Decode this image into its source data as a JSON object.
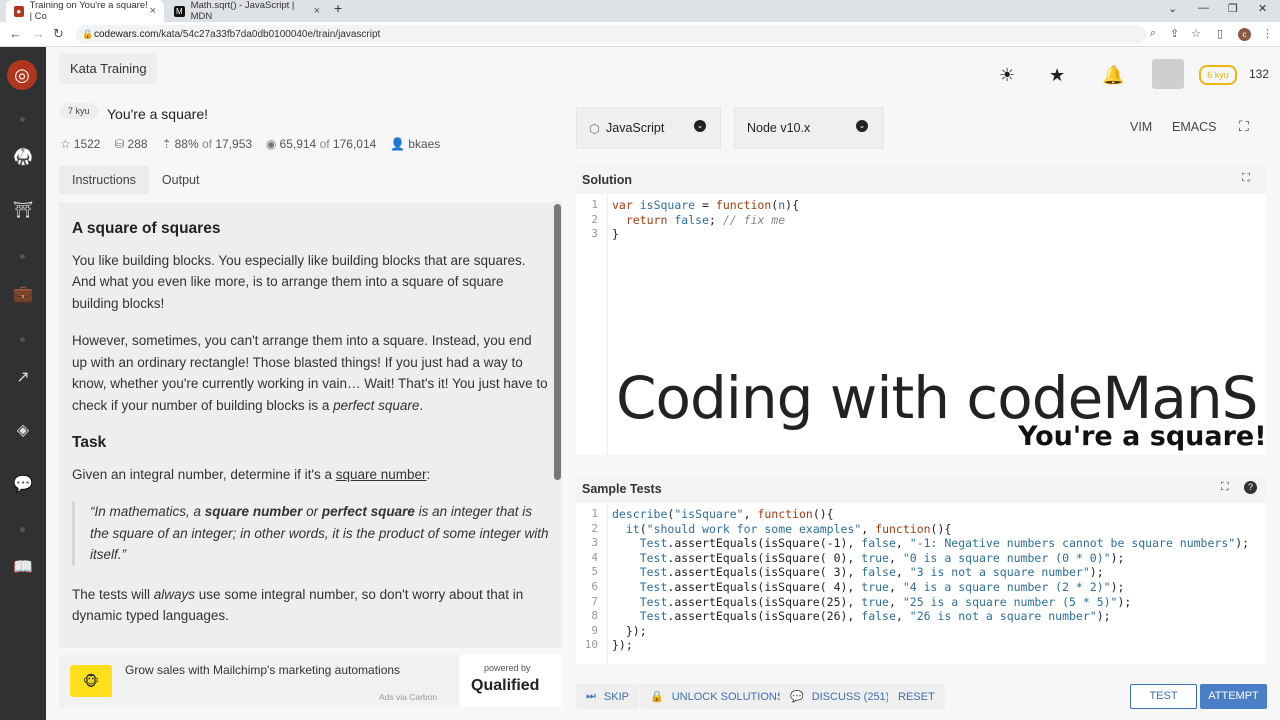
{
  "browser": {
    "tabs": [
      {
        "title": "Training on You're a square! | Co",
        "active": true
      },
      {
        "title": "Math.sqrt() - JavaScript | MDN",
        "active": false
      }
    ],
    "url_host": "codewars.com",
    "url_path": "/kata/54c27a33fb7da0db0100040e/train/javascript",
    "profile_initial": "c"
  },
  "header": {
    "section_label": "Kata Training",
    "rank_badge": "6 kyu",
    "honor": "132"
  },
  "kata": {
    "kyu": "7 kyu",
    "title": "You're a square!",
    "stars": "1522",
    "collections": "288",
    "satisfaction": "88%",
    "votes": "17,953",
    "completed": "65,914",
    "attempted": "176,014",
    "author": "bkaes"
  },
  "left_tabs": [
    "Instructions",
    "Output"
  ],
  "description": {
    "heading1": "A square of squares",
    "p1": "You like building blocks. You especially like building blocks that are squares. And what you even like more, is to arrange them into a square of square building blocks!",
    "p2a": "However, sometimes, you can't arrange them into a square. Instead, you end up with an ordinary rectangle! Those blasted things! If you just had a way to know, whether you're currently working in vain… Wait! That's it! You just have to check if your number of building blocks is a ",
    "p2em": "perfect square",
    "p2b": ".",
    "heading2": "Task",
    "p3a": "Given an integral number, determine if it's a ",
    "p3link": "square number",
    "p3b": ":",
    "q1": "“In mathematics, a ",
    "q2": "square number",
    "q3": " or ",
    "q4": "perfect square",
    "q5": " is an integer that is the square of an integer; in other words, it is the product of some integer with itself.”",
    "p4a": "The tests will ",
    "p4em": "always",
    "p4b": " use some integral number, so don't worry about that in dynamic typed languages."
  },
  "ad": {
    "text": "Grow sales with Mailchimp's marketing automations",
    "via": "Ads via Carbon",
    "powered_by": "powered by",
    "brand": "Qualified"
  },
  "editor": {
    "language": "JavaScript",
    "runtime": "Node v10.x",
    "mode_vim": "VIM",
    "mode_emacs": "EMACS",
    "solution_title": "Solution",
    "tests_title": "Sample Tests"
  },
  "overlay": {
    "line1": "Coding with codeManS",
    "line2": "You're a square!"
  },
  "buttons": {
    "skip": "SKIP",
    "unlock": "UNLOCK SOLUTIONS",
    "discuss": "DISCUSS (251)",
    "reset": "RESET",
    "test": "TEST",
    "attempt": "ATTEMPT"
  }
}
